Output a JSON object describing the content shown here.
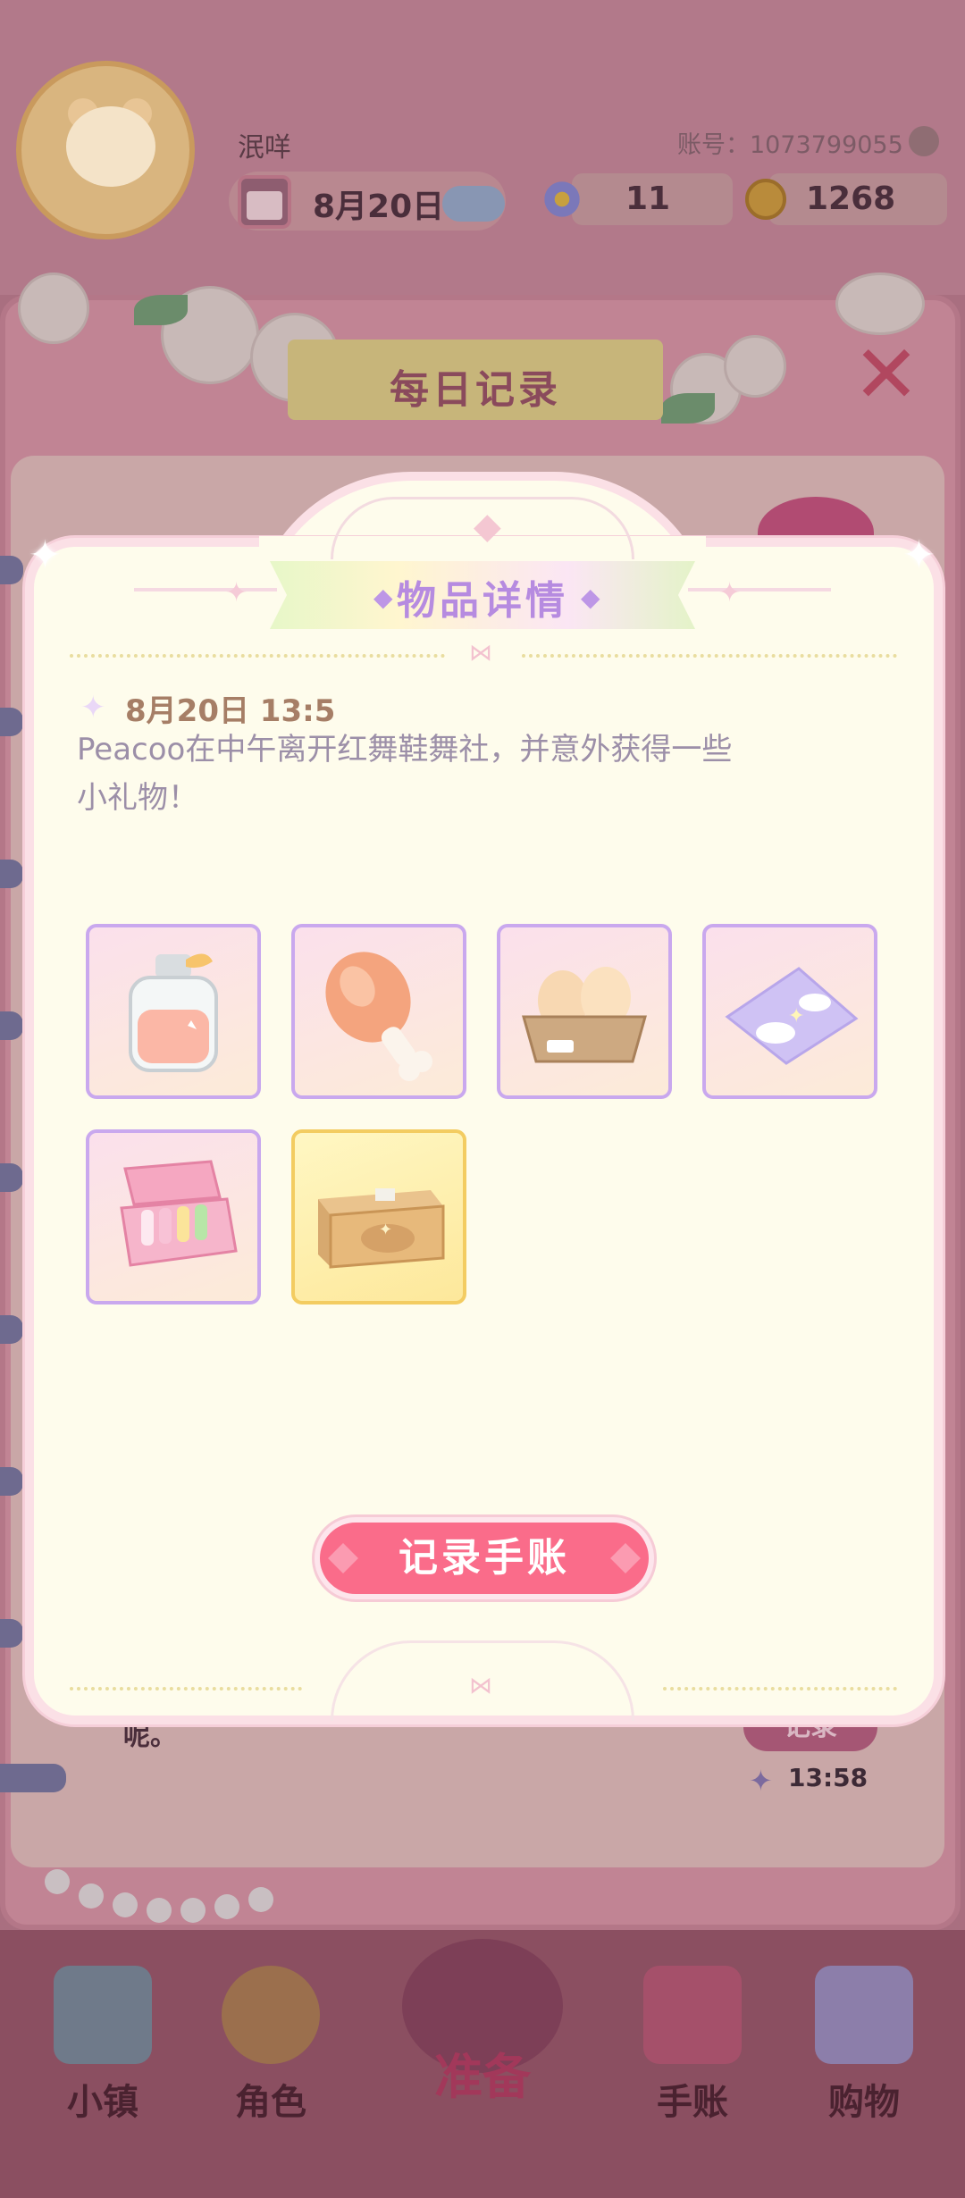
{
  "topbar": {
    "player_name": "泯咩",
    "account": "账号：1073799055",
    "date": "8月20日",
    "gems": "11",
    "coins": "1268"
  },
  "journal": {
    "title": "每日记录",
    "close": "✕",
    "peek_text": "呢。",
    "peek_record_button": "记录",
    "peek_time": "13:58"
  },
  "modal": {
    "title": "物品详情",
    "entry_time": "8月20日  13:5",
    "entry_text_line1": "Peacoo在中午离开红舞鞋舞社，并意外获得一些",
    "entry_text_line2": "小礼物！",
    "items": [
      {
        "icon": "perfume-bottle-icon",
        "frame": "purple"
      },
      {
        "icon": "chicken-drumstick-icon",
        "frame": "purple"
      },
      {
        "icon": "egg-carton-icon",
        "frame": "purple"
      },
      {
        "icon": "cloud-handkerchief-icon",
        "frame": "purple"
      },
      {
        "icon": "makeup-box-icon",
        "frame": "purple"
      },
      {
        "icon": "cardboard-box-icon",
        "frame": "gold"
      }
    ],
    "record_button": "记录手账"
  },
  "bottom_nav": [
    {
      "label": "小镇",
      "icon": "town-map-icon"
    },
    {
      "label": "角色",
      "icon": "character-icon"
    },
    {
      "label": "准备",
      "icon": "prepare-icon"
    },
    {
      "label": "手账",
      "icon": "journal-book-icon"
    },
    {
      "label": "购物",
      "icon": "shopping-bag-icon"
    }
  ],
  "colors": {
    "accent_pink": "#fa6c8a",
    "modal_bg": "#fefcec",
    "title_purple": "#b68be0",
    "dim_overlay": "#6e4a5c"
  }
}
